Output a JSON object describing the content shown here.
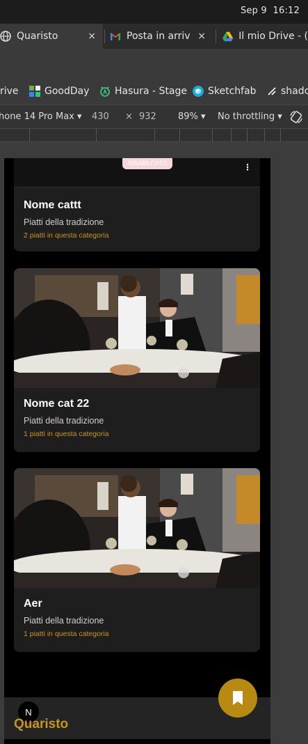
{
  "os": {
    "date": "Sep 9",
    "time": "16:12"
  },
  "tabs": [
    {
      "title": "Quaristo",
      "close": "×"
    },
    {
      "title": "Posta in arriv",
      "close": "×"
    },
    {
      "title": "Il mio Drive - (",
      "close": ""
    }
  ],
  "bookmarks": [
    {
      "label": "rive"
    },
    {
      "label": "GoodDay"
    },
    {
      "label": "Hasura - Stage"
    },
    {
      "label": "Sketchfab"
    },
    {
      "label": "shadc"
    }
  ],
  "devtools": {
    "device": "hone 14 Pro Max ▾",
    "width": "430",
    "times": "×",
    "height": "932",
    "zoom": "89% ▾",
    "throttle": "No throttling ▾"
  },
  "top_card": {
    "badge": "DISABILITATO",
    "menu": "⋮"
  },
  "categories": [
    {
      "name": "Nome cattt",
      "description": "Piatti della tradizione",
      "count": "2 piatti in questa categoria"
    },
    {
      "name": "Nome cat 22",
      "description": "Piatti della tradizione",
      "count": "1 piatti in questa categoria"
    },
    {
      "name": "Aer",
      "description": "Piatti della tradizione",
      "count": "1 piatti in questa categoria"
    }
  ],
  "footer": {
    "brand": "Quaristo",
    "next_badge": "N"
  },
  "colors": {
    "accent": "#b88a12",
    "accent_text": "#c9941a",
    "card_bg": "#1e1e1e",
    "page_bg": "#000000"
  }
}
